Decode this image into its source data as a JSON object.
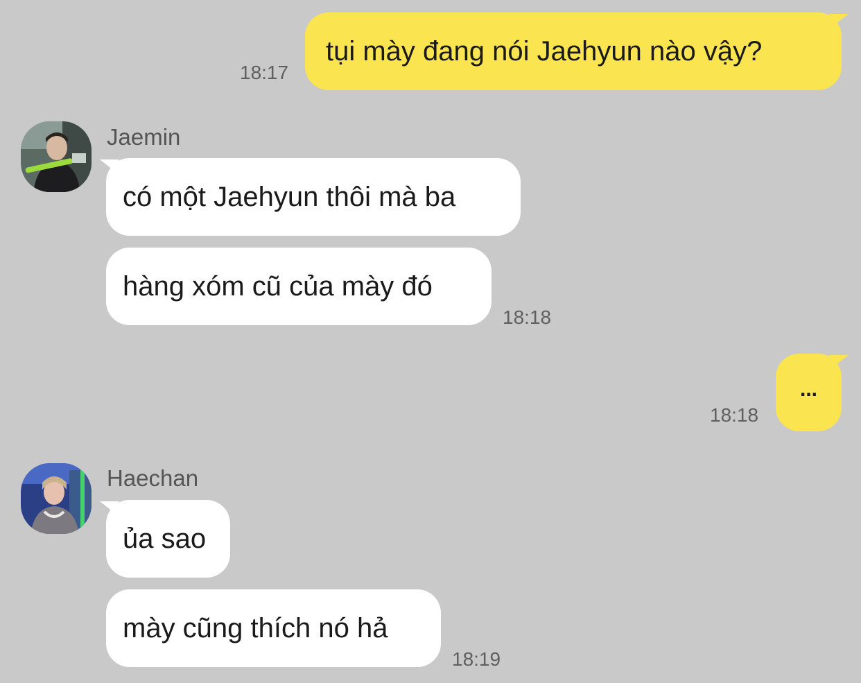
{
  "messages": [
    {
      "type": "outgoing",
      "text": "tụi mày đang nói Jaehyun nào vậy?",
      "time": "18:17"
    },
    {
      "type": "incoming",
      "sender": "Jaemin",
      "avatar": "jaemin-avatar",
      "lines": [
        "có một Jaehyun thôi mà ba",
        "hàng xóm cũ của mày đó"
      ],
      "time": "18:18"
    },
    {
      "type": "outgoing",
      "text": "...",
      "time": "18:18"
    },
    {
      "type": "incoming",
      "sender": "Haechan",
      "avatar": "haechan-avatar",
      "lines": [
        "ủa sao",
        "mày cũng thích nó hả"
      ],
      "time": "18:19"
    }
  ],
  "colors": {
    "background": "#c9c9c9",
    "outgoing_bubble": "#fae44f",
    "incoming_bubble": "#ffffff",
    "timestamp": "#5f5f5f",
    "sender_name": "#555555"
  }
}
